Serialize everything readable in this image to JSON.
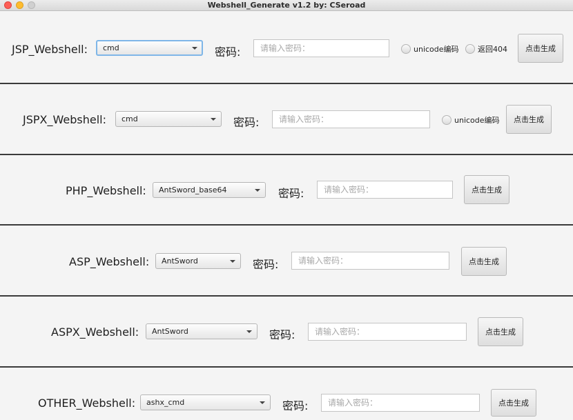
{
  "window": {
    "title": "Webshell_Generate v1.2  by: CSeroad"
  },
  "sections": [
    {
      "label": "JSP_Webshell:",
      "select_value": "cmd",
      "password_label": "密码:",
      "password_placeholder": "请输入密码：",
      "unicode_label": "unicode编码",
      "return404_label": "返回404",
      "button_label": "点击生成"
    },
    {
      "label": "JSPX_Webshell:",
      "select_value": "cmd",
      "password_label": "密码:",
      "password_placeholder": "请输入密码：",
      "unicode_label": "unicode编码",
      "button_label": "点击生成"
    },
    {
      "label": "PHP_Webshell:",
      "select_value": "AntSword_base64",
      "password_label": "密码:",
      "password_placeholder": "请输入密码：",
      "button_label": "点击生成"
    },
    {
      "label": "ASP_Webshell:",
      "select_value": "AntSword",
      "password_label": "密码:",
      "password_placeholder": "请输入密码：",
      "button_label": "点击生成"
    },
    {
      "label": "ASPX_Webshell:",
      "select_value": "AntSword",
      "password_label": "密码:",
      "password_placeholder": "请输入密码：",
      "button_label": "点击生成"
    },
    {
      "label": "OTHER_Webshell:",
      "select_value": "ashx_cmd",
      "password_label": "密码:",
      "password_placeholder": "请输入密码：",
      "button_label": "点击生成"
    }
  ]
}
